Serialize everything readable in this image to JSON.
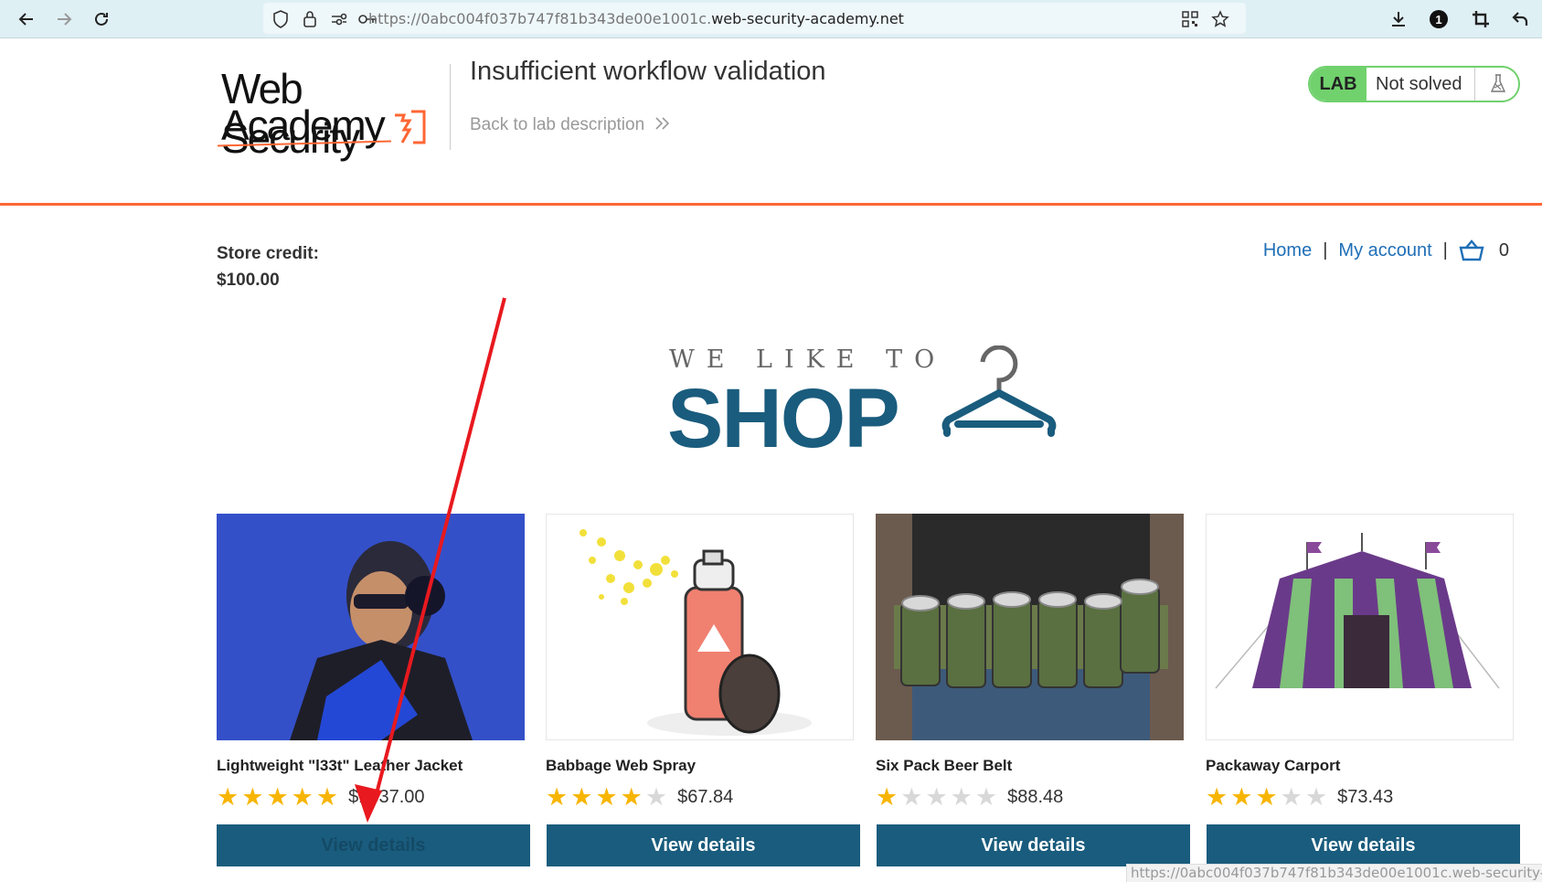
{
  "browser": {
    "url_prefix": "https://0abc004f037b747f81b343de00e1001c.",
    "url_domain": "web-security-academy.net",
    "status_url": "https://0abc004f037b747f81b343de00e1001c.web-security-aca",
    "badge_count": "1"
  },
  "lab": {
    "logo_line1": "Web Security",
    "logo_line2": "Academy",
    "title": "Insufficient workflow validation",
    "back_link": "Back to lab description",
    "status_tag": "LAB",
    "status_text": "Not solved",
    "accent_color": "#ff6633",
    "solved_color": "#70d16d"
  },
  "store": {
    "credit_label": "Store credit:",
    "credit_value": "$100.00",
    "nav": {
      "home": "Home",
      "separator": "|",
      "account": "My account",
      "cart_count": "0"
    },
    "banner": {
      "tagline": "WE LIKE TO",
      "headline": "SHOP"
    }
  },
  "products": [
    {
      "name": "Lightweight \"l33t\" Leather Jacket",
      "price": "$1337.00",
      "rating": 5,
      "button": "View details"
    },
    {
      "name": "Babbage Web Spray",
      "price": "$67.84",
      "rating": 4,
      "button": "View details"
    },
    {
      "name": "Six Pack Beer Belt",
      "price": "$88.48",
      "rating": 1,
      "button": "View details"
    },
    {
      "name": "Packaway Carport",
      "price": "$73.43",
      "rating": 3,
      "button": "View details"
    }
  ],
  "theme": {
    "primary": "#1a5c7d",
    "link": "#1f6fb7",
    "star": "#f7b500"
  }
}
